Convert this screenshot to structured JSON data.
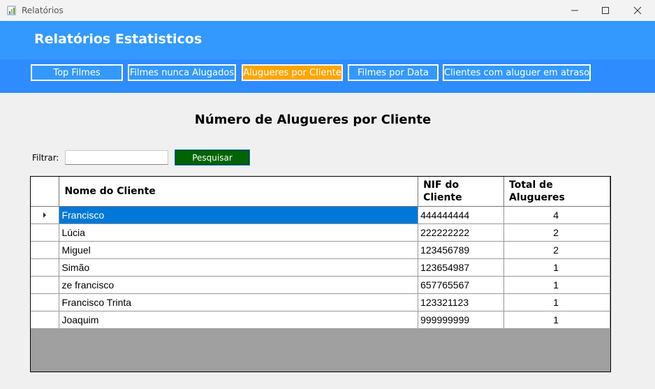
{
  "window": {
    "title": "Relatórios"
  },
  "header": {
    "title": "Relatórios Estatisticos"
  },
  "nav": {
    "top_filmes": "Top Filmes",
    "nunca_alugados": "Filmes nunca Alugados",
    "alugueres_cliente": "Alugueres por Cliente",
    "filmes_data": "Filmes por Data",
    "clientes_atraso": "Clientes com aluguer em atraso"
  },
  "report": {
    "title": "Número de Alugueres por Cliente"
  },
  "filter": {
    "label": "Filtrar:",
    "value": "",
    "button": "Pesquisar"
  },
  "grid": {
    "headers": {
      "nome": "Nome do Cliente",
      "nif_1": "NIF do",
      "nif_2": "Cliente",
      "total_1": "Total de",
      "total_2": "Alugueres"
    },
    "rows": [
      {
        "nome": "Francisco",
        "nif": "444444444",
        "total": "4"
      },
      {
        "nome": "Lúcia",
        "nif": "222222222",
        "total": "2"
      },
      {
        "nome": "Miguel",
        "nif": "123456789",
        "total": "2"
      },
      {
        "nome": "Simão",
        "nif": "123654987",
        "total": "1"
      },
      {
        "nome": "ze francisco",
        "nif": "657765567",
        "total": "1"
      },
      {
        "nome": "Francisco Trinta",
        "nif": "123321123",
        "total": "1"
      },
      {
        "nome": "Joaquim",
        "nif": "999999999",
        "total": "1"
      }
    ]
  },
  "colors": {
    "header_bg": "#3399ff",
    "nav_bg": "#2e8cff",
    "active_tab": "#ffa500",
    "search_button": "#006400",
    "selection": "#0078d7",
    "grid_empty": "#a0a0a0"
  }
}
